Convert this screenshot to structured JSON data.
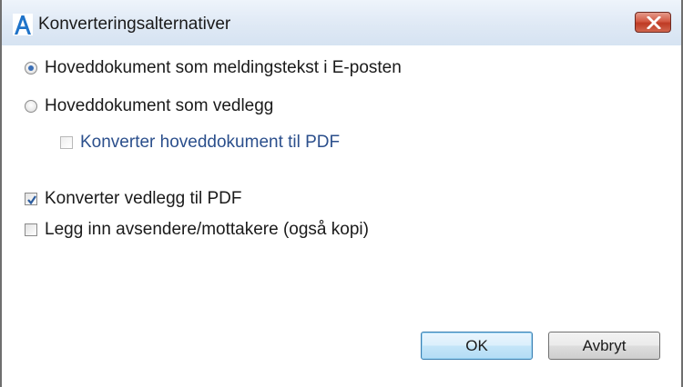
{
  "window": {
    "title": "Konverteringsalternativer",
    "app_icon": "letter-A-icon",
    "close_icon": "close-x-icon"
  },
  "options": {
    "radio_body": {
      "label": "Hoveddokument som meldingstekst i E-posten",
      "selected": true
    },
    "radio_attachment": {
      "label": "Hoveddokument som vedlegg",
      "selected": false
    },
    "convert_main_pdf": {
      "label": "Konverter hoveddokument til PDF",
      "checked": false,
      "enabled": false
    },
    "convert_attachments_pdf": {
      "label": "Konverter vedlegg til PDF",
      "checked": true
    },
    "add_recipients": {
      "label": "Legg inn avsendere/mottakere (også kopi)",
      "checked": false
    }
  },
  "buttons": {
    "ok": "OK",
    "cancel": "Avbryt"
  },
  "colors": {
    "accent": "#3b6fb6",
    "disabled_label": "#2b4f8c",
    "close_button": "#c9442d"
  }
}
